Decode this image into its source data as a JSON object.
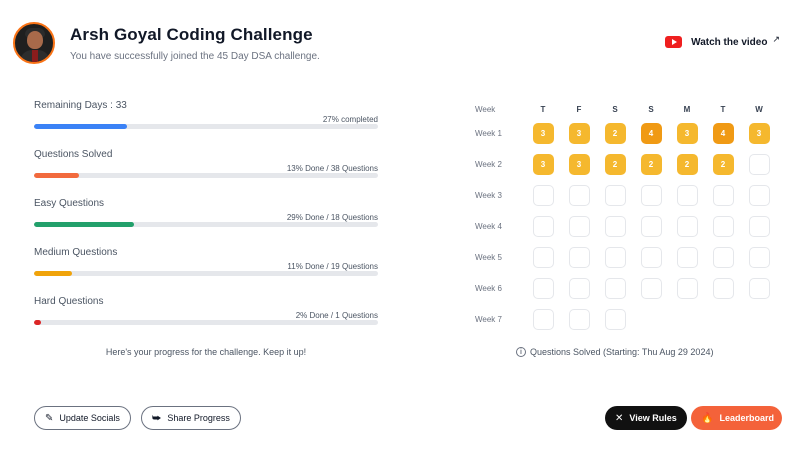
{
  "header": {
    "title": "Arsh Goyal Coding Challenge",
    "subtitle": "You have successfully joined the 45 Day DSA challenge.",
    "watch_label": "Watch the video",
    "watch_icon": "youtube-icon",
    "external_icon": "external-link-icon"
  },
  "progress": [
    {
      "label": "Remaining Days : 33",
      "meta": "27% completed",
      "percent": 27,
      "color": "#3b82f6"
    },
    {
      "label": "Questions Solved",
      "meta": "13% Done / 38 Questions",
      "percent": 13,
      "color": "#f26a3d"
    },
    {
      "label": "Easy Questions",
      "meta": "29% Done / 18 Questions",
      "percent": 29,
      "color": "#22a06b"
    },
    {
      "label": "Medium Questions",
      "meta": "11% Done / 19 Questions",
      "percent": 11,
      "color": "#f0a30a"
    },
    {
      "label": "Hard Questions",
      "meta": "2% Done / 1 Questions",
      "percent": 2,
      "color": "#dc2626"
    }
  ],
  "progress_note": "Here's your progress for the challenge. Keep it up!",
  "calendar": {
    "header_label": "Week",
    "days": [
      "T",
      "F",
      "S",
      "S",
      "M",
      "T",
      "W"
    ],
    "weeks": [
      {
        "label": "Week 1",
        "cells": [
          "3",
          "3",
          "2",
          "4",
          "3",
          "4",
          "3"
        ]
      },
      {
        "label": "Week 2",
        "cells": [
          "3",
          "3",
          "2",
          "2",
          "2",
          "2",
          ""
        ]
      },
      {
        "label": "Week 3",
        "cells": [
          "",
          "",
          "",
          "",
          "",
          "",
          ""
        ]
      },
      {
        "label": "Week 4",
        "cells": [
          "",
          "",
          "",
          "",
          "",
          "",
          ""
        ]
      },
      {
        "label": "Week 5",
        "cells": [
          "",
          "",
          "",
          "",
          "",
          "",
          ""
        ]
      },
      {
        "label": "Week 6",
        "cells": [
          "",
          "",
          "",
          "",
          "",
          "",
          ""
        ]
      },
      {
        "label": "Week 7",
        "cells": [
          "",
          "",
          ""
        ]
      }
    ],
    "note": "Questions Solved (Starting: Thu Aug 29 2024)",
    "colors": {
      "level_2_3": "#f5b82e",
      "level_4": "#f09a14"
    }
  },
  "buttons": {
    "update_socials": "Update Socials",
    "share_progress": "Share Progress",
    "view_rules": "View Rules",
    "leaderboard": "Leaderboard"
  }
}
